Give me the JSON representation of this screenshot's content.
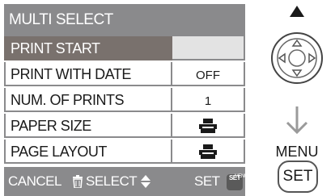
{
  "title": "MULTI SELECT",
  "rows": [
    {
      "label": "PRINT START",
      "value": ""
    },
    {
      "label": "PRINT WITH DATE",
      "value": "OFF"
    },
    {
      "label": "NUM. OF PRINTS",
      "value": "1"
    },
    {
      "label": "PAPER SIZE",
      "value": ""
    },
    {
      "label": "PAGE LAYOUT",
      "value": ""
    }
  ],
  "footer": {
    "cancel": "CANCEL",
    "select": "SELECT",
    "set": "SET",
    "menu_tag_top": "MENU",
    "menu_tag_bottom": "SET"
  },
  "controls": {
    "menu_label": "MENU",
    "set_label": "SET"
  },
  "icons": {
    "paper_size": "printer-icon",
    "page_layout": "printer-icon",
    "cancel": "trash-icon",
    "select": "up-down-triangle-icon",
    "dpad": "cursor-pad-icon",
    "arrow": "down-arrow-icon"
  },
  "colors": {
    "bar": "#8a8a8c",
    "selected": "#79716d",
    "text": "#1a1a1a"
  }
}
